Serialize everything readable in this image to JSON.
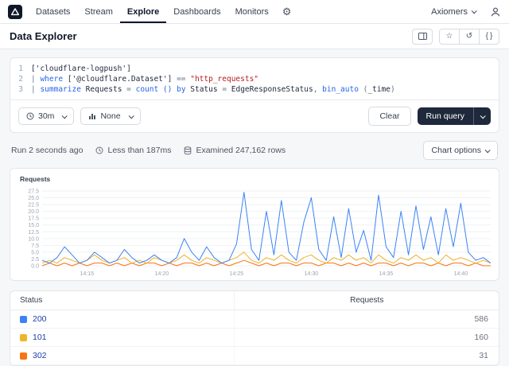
{
  "navbar": {
    "items": [
      {
        "label": "Datasets",
        "active": false
      },
      {
        "label": "Stream",
        "active": false
      },
      {
        "label": "Explore",
        "active": true
      },
      {
        "label": "Dashboards",
        "active": false
      },
      {
        "label": "Monitors",
        "active": false
      }
    ],
    "org_label": "Axiomers"
  },
  "page": {
    "title": "Data Explorer"
  },
  "editor": {
    "lines": [
      {
        "num": "1",
        "tokens": [
          {
            "text": "['cloudflare-logpush']",
            "type": "ident"
          }
        ]
      },
      {
        "num": "2",
        "tokens": [
          {
            "text": "| ",
            "type": "op"
          },
          {
            "text": "where ",
            "type": "kw"
          },
          {
            "text": "['@cloudflare.Dataset'] ",
            "type": "ident"
          },
          {
            "text": "== ",
            "type": "op"
          },
          {
            "text": "\"http_requests\"",
            "type": "str"
          }
        ]
      },
      {
        "num": "3",
        "tokens": [
          {
            "text": "| ",
            "type": "op"
          },
          {
            "text": "summarize ",
            "type": "kw"
          },
          {
            "text": "Requests ",
            "type": "ident"
          },
          {
            "text": "= ",
            "type": "op"
          },
          {
            "text": "count ()",
            "type": "kw"
          },
          {
            "text": " ",
            "type": "op"
          },
          {
            "text": "by ",
            "type": "kw"
          },
          {
            "text": "Status ",
            "type": "ident"
          },
          {
            "text": "= ",
            "type": "op"
          },
          {
            "text": "EdgeResponseStatus",
            "type": "ident"
          },
          {
            "text": ", ",
            "type": "op"
          },
          {
            "text": "bin_auto",
            "type": "kw"
          },
          {
            "text": " (",
            "type": "op"
          },
          {
            "text": "_time",
            "type": "ident"
          },
          {
            "text": ")",
            "type": "op"
          }
        ]
      }
    ]
  },
  "toolbar": {
    "time_range_label": "30m",
    "compare_label": "None",
    "clear_label": "Clear",
    "run_label": "Run query"
  },
  "statusbar": {
    "run_text": "Run 2 seconds ago",
    "duration_text": "Less than 187ms",
    "examined_text": "Examined 247,162 rows",
    "chart_options_label": "Chart options"
  },
  "chart_data": {
    "type": "line",
    "title": "Requests",
    "x_ticks": [
      "14:15",
      "14:20",
      "14:25",
      "14:30",
      "14:35",
      "14:40"
    ],
    "x_tick_positions": [
      0.1,
      0.2667,
      0.4333,
      0.6,
      0.7667,
      0.9333
    ],
    "y_ticks": [
      0.0,
      2.5,
      5.0,
      7.5,
      10.0,
      12.5,
      15.0,
      17.5,
      20.0,
      22.5,
      25.0,
      27.5
    ],
    "ylim": [
      0,
      27.5
    ],
    "grid": true,
    "legend_position": "table-below",
    "series": [
      {
        "name": "200",
        "color": "#3b82f6",
        "values": [
          2,
          1,
          3,
          7,
          4,
          1,
          2,
          5,
          3,
          1,
          2,
          6,
          3,
          1,
          2,
          4,
          2,
          1,
          3,
          10,
          5,
          2,
          7,
          3,
          1,
          2,
          8,
          27,
          6,
          2,
          20,
          4,
          24,
          5,
          2,
          16,
          25,
          6,
          2,
          18,
          3,
          21,
          5,
          13,
          2,
          26,
          7,
          3,
          20,
          4,
          22,
          6,
          18,
          4,
          21,
          7,
          23,
          5,
          2,
          3,
          1
        ]
      },
      {
        "name": "101",
        "color": "#f0b429",
        "values": [
          1,
          2,
          1,
          3,
          2,
          1,
          2,
          4,
          2,
          1,
          2,
          3,
          1,
          2,
          1,
          3,
          2,
          1,
          2,
          4,
          2,
          1,
          3,
          2,
          1,
          2,
          3,
          5,
          2,
          1,
          3,
          2,
          4,
          2,
          1,
          3,
          4,
          2,
          1,
          3,
          2,
          4,
          2,
          3,
          1,
          4,
          2,
          1,
          3,
          2,
          4,
          2,
          3,
          1,
          4,
          2,
          3,
          2,
          1,
          2,
          1
        ]
      },
      {
        "name": "302",
        "color": "#f97316",
        "values": [
          0,
          1,
          0,
          1,
          0,
          1,
          0,
          1,
          1,
          0,
          1,
          0,
          1,
          0,
          1,
          1,
          0,
          1,
          0,
          1,
          1,
          0,
          1,
          0,
          1,
          0,
          1,
          2,
          1,
          0,
          1,
          0,
          1,
          1,
          0,
          1,
          1,
          0,
          1,
          1,
          0,
          1,
          0,
          1,
          0,
          1,
          1,
          0,
          1,
          0,
          1,
          1,
          0,
          1,
          0,
          1,
          1,
          0,
          1,
          0,
          0
        ]
      }
    ]
  },
  "table": {
    "headers": [
      "Status",
      "Requests"
    ],
    "rows": [
      {
        "status": "200",
        "requests": "586",
        "color": "#3b82f6"
      },
      {
        "status": "101",
        "requests": "160",
        "color": "#f0b429"
      },
      {
        "status": "302",
        "requests": "31",
        "color": "#f97316"
      }
    ]
  }
}
